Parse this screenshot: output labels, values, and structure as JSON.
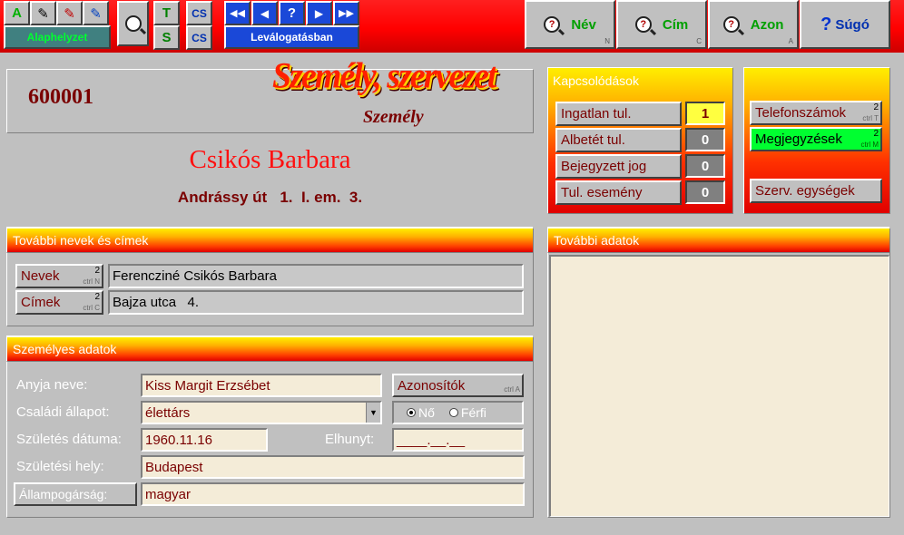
{
  "toolbar": {
    "filter_buttons": [
      "A",
      "✎",
      "✎",
      "✎"
    ],
    "reset_label": "Alaphelyzet",
    "search_buttons": [
      "T",
      "CS",
      "S",
      "CS"
    ],
    "filter_state_label": "Leválogatásban",
    "nav_arrows": [
      "◀◀",
      "◀",
      "?",
      "▶",
      "▶▶"
    ],
    "nav": [
      {
        "label": "Név",
        "hint": "N"
      },
      {
        "label": "Cím",
        "hint": "C"
      },
      {
        "label": "Azon",
        "hint": "A"
      },
      {
        "label": "Súgó",
        "hint": ""
      }
    ]
  },
  "header": {
    "id": "600001",
    "logo_text": "Személy, szervezet",
    "type": "Személy",
    "name": "Csikós Barbara",
    "address": "Andrássy út   1.  I. em.  3."
  },
  "links": {
    "title": "Kapcsolódások",
    "items": [
      {
        "label": "Ingatlan tul.",
        "count": "1"
      },
      {
        "label": "Albetét tul.",
        "count": "0"
      },
      {
        "label": "Bejegyzett jog",
        "count": "0"
      },
      {
        "label": "Tul. esemény",
        "count": "0"
      }
    ]
  },
  "side": {
    "phones": {
      "label": "Telefonszámok",
      "count": "2",
      "hint": "ctrl T"
    },
    "notes": {
      "label": "Megjegyzések",
      "count": "2",
      "hint": "ctrl M"
    },
    "units": {
      "label": "Szerv. egységek"
    }
  },
  "names_section": {
    "title": "További nevek és címek",
    "names_label": "Nevek",
    "names_count": "2",
    "names_hint": "ctrl N",
    "names_value": "Ferencziné Csikós Barbara",
    "addr_label": "Címek",
    "addr_count": "2",
    "addr_hint": "ctrl C",
    "addr_value": "Bajza utca   4."
  },
  "personal": {
    "title": "Személyes adatok",
    "mother_label": "Anyja neve:",
    "mother_value": "Kiss Margit Erzsébet",
    "ids_label": "Azonosítók",
    "ids_hint": "ctrl A",
    "marital_label": "Családi állapot:",
    "marital_value": "élettárs",
    "gender_female": "Nő",
    "gender_male": "Férfi",
    "birth_label": "Születés dátuma:",
    "birth_value": "1960.11.16",
    "death_label": "Elhunyt:",
    "death_value": "____.__.__",
    "place_label": "Születési hely:",
    "place_value": "Budapest",
    "citizen_label": "Állampogárság:",
    "citizen_value": "magyar"
  },
  "extra": {
    "title": "További adatok"
  },
  "colors": {
    "accent": "#ff0000",
    "field_text": "#7a0000",
    "green": "#00ff30"
  }
}
